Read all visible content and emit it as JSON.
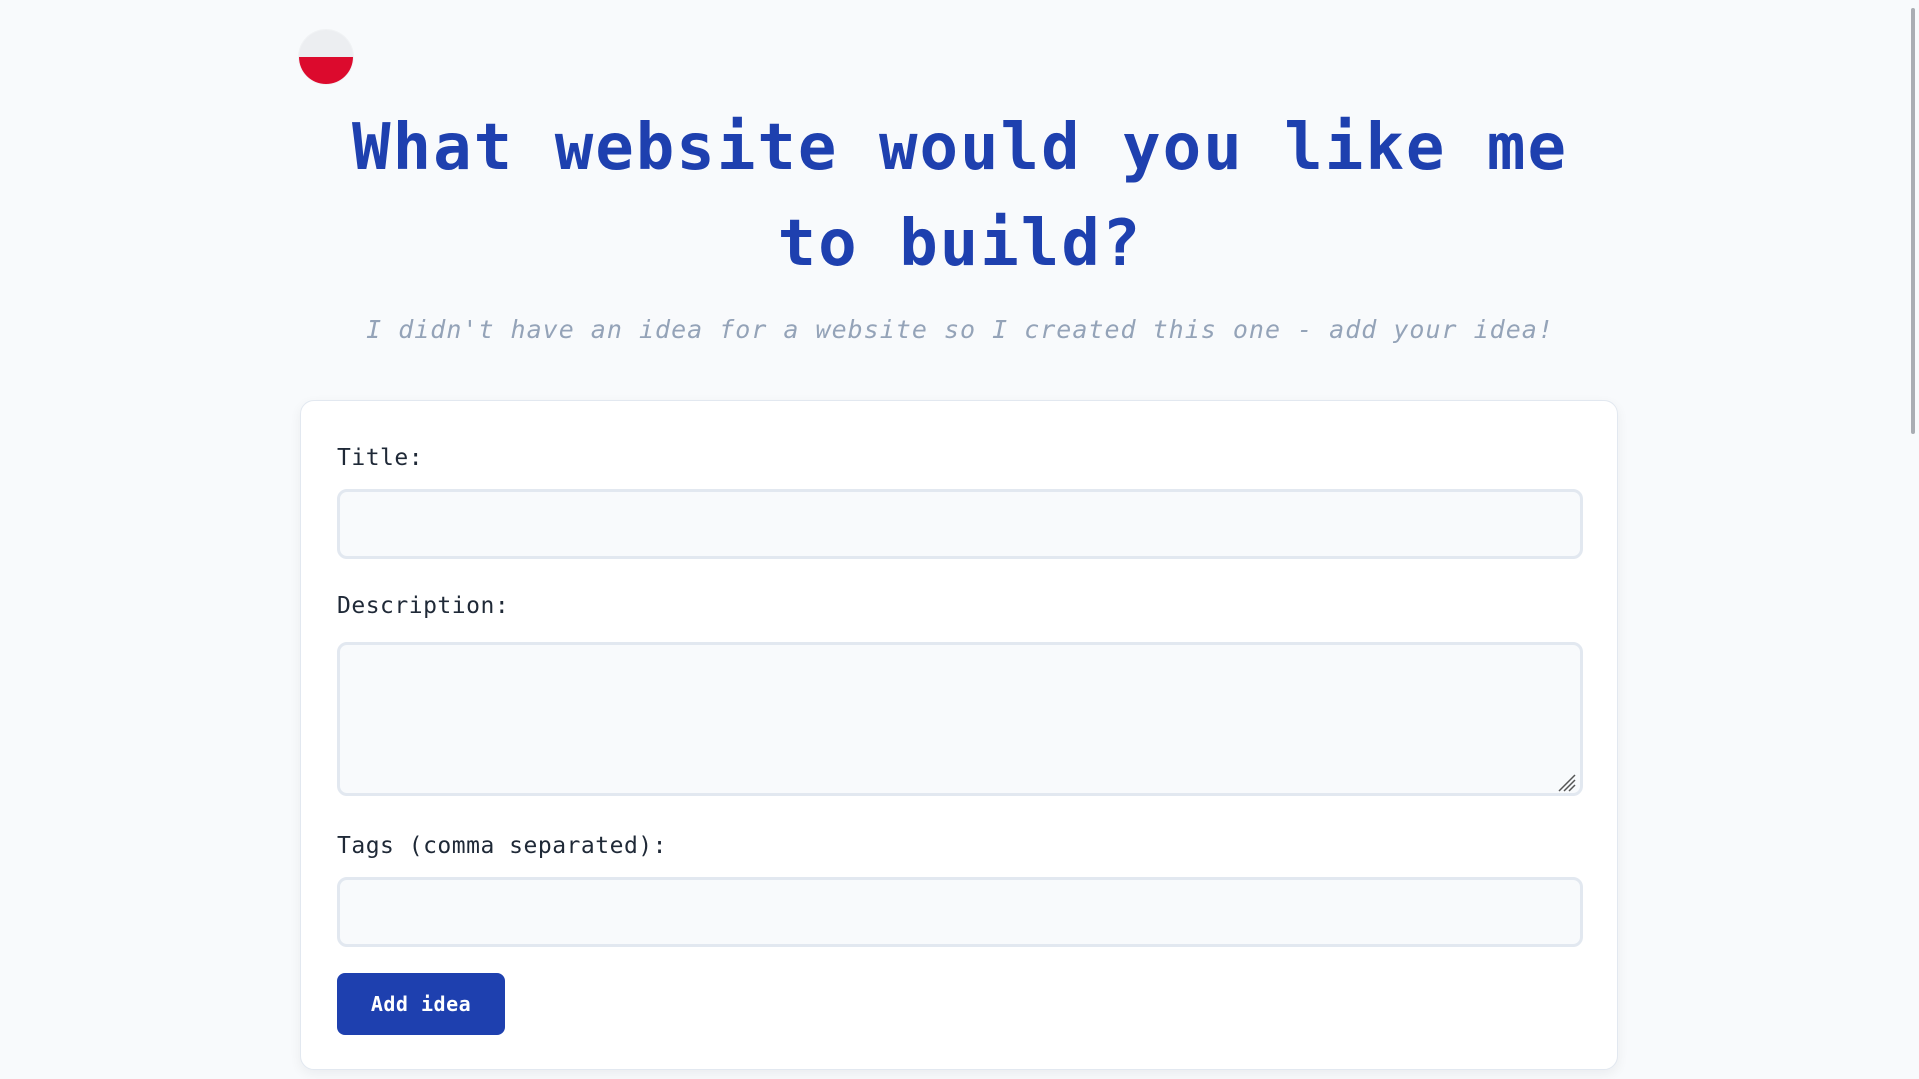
{
  "header": {
    "language_flag": "poland-flag-icon",
    "title": "What website would you like me to build?",
    "subtitle": "I didn't have an idea for a website so I created this one - add your idea!"
  },
  "form": {
    "title_label": "Title:",
    "title_value": "",
    "title_placeholder": "",
    "description_label": "Description:",
    "description_value": "",
    "description_placeholder": "",
    "tags_label": "Tags (comma separated):",
    "tags_value": "",
    "tags_placeholder": "",
    "submit_label": "Add idea"
  },
  "colors": {
    "accent": "#1e40af",
    "subtitle": "#94a3b8",
    "background": "#f8fafc",
    "flag_white": "#eceef1",
    "flag_red": "#dc0a2d"
  }
}
